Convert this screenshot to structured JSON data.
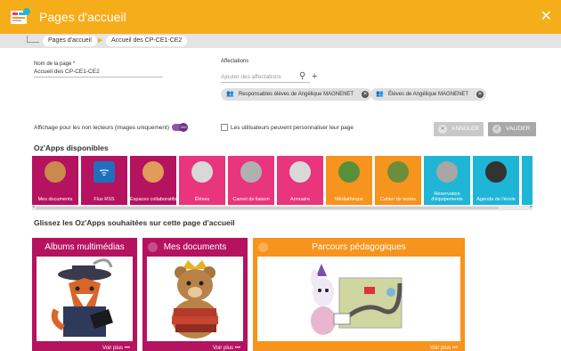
{
  "window": {
    "title": "Pages d'accueil",
    "close": "✕"
  },
  "breadcrumb": {
    "items": [
      "Pages d'accueil",
      "Accueil des CP-CE1-CE2"
    ],
    "sep": "▶"
  },
  "form": {
    "page_name_label": "Nom de la page *",
    "page_name_value": "Accueil des CP-CE1-CE2",
    "affectations_label": "Affectations",
    "affectations_placeholder": "Ajouter des affectations",
    "chips": [
      "Responsables élèves de Angélique MAGNENET",
      "Élèves de Angélique MAGNENET"
    ],
    "non_readers_label": "Affichage pour les non lecteurs (images uniquement)",
    "toggle_text": "OUI",
    "customize_label": "Les utilisateurs peuvent personnaliser leur page",
    "cancel_label": "ANNULER",
    "validate_label": "VALIDER"
  },
  "apps": {
    "title": "Oz'Apps disponibles",
    "tiles": [
      {
        "label": "Mes documents",
        "color": "#b5125f"
      },
      {
        "label": "Flux RSS",
        "color": "#b5125f"
      },
      {
        "label": "Espaces collaboratifs",
        "color": "#b5125f"
      },
      {
        "label": "Élèves",
        "color": "#e8357c"
      },
      {
        "label": "Carnet de liaison",
        "color": "#e8357c"
      },
      {
        "label": "Annuaire",
        "color": "#e8357c"
      },
      {
        "label": "Médiathèque",
        "color": "#f7941d"
      },
      {
        "label": "Cahier de textes",
        "color": "#f7941d"
      },
      {
        "label": "Réservation d'équipements",
        "color": "#1fb5d6"
      },
      {
        "label": "Agenda de l'école",
        "color": "#1fb5d6"
      }
    ]
  },
  "dropzone": {
    "title": "Glissez les Oz'Apps souhaitées sur cette page d'accueil",
    "cards": [
      {
        "title": "Albums multimédias",
        "more": "Voir plus •••",
        "color": "#b5125f"
      },
      {
        "title": "Mes documents",
        "more": "Voir plus •••",
        "color": "#b5125f"
      },
      {
        "title": "Parcours pédagogiques",
        "more": "Voir plus •••",
        "color": "#f7941d"
      }
    ]
  }
}
